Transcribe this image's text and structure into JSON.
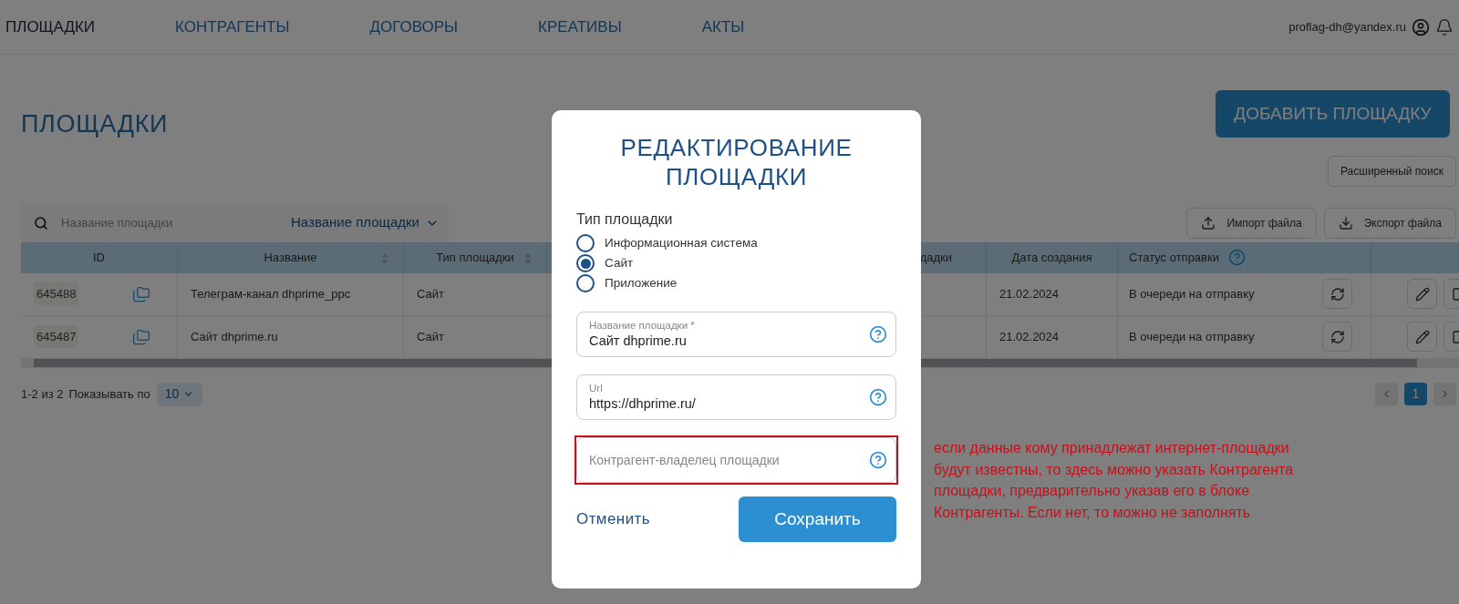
{
  "nav": {
    "items": [
      {
        "label": "ПЛОЩАДКИ",
        "selected": true
      },
      {
        "label": "КОНТРАГЕНТЫ",
        "selected": false
      },
      {
        "label": "ДОГОВОРЫ",
        "selected": false
      },
      {
        "label": "КРЕАТИВЫ",
        "selected": false
      },
      {
        "label": "АКТЫ",
        "selected": false
      }
    ],
    "user_email": "proflag-dh@yandex.ru"
  },
  "page": {
    "title": "ПЛОЩАДКИ",
    "add_button": "ДОБАВИТЬ ПЛОЩАДКУ",
    "advanced_search_button": "Расширенный поиск",
    "search": {
      "placeholder": "Название площадки",
      "field_select": "Название площадки"
    },
    "import_button": "Импорт файла",
    "export_button": "Экспорт файла"
  },
  "table": {
    "columns": [
      {
        "label": "ID",
        "sortable": false
      },
      {
        "label": "Название",
        "sortable": true
      },
      {
        "label": "Тип площадки",
        "sortable": true
      },
      {
        "label": "дадки"
      },
      {
        "label": "Дата создания",
        "sortable": false
      },
      {
        "label": "Статус отправки",
        "sortable": false
      }
    ],
    "rows": [
      {
        "id": "645488",
        "name": "Телеграм-канал dhprime_ppc",
        "type": "Сайт",
        "created": "21.02.2024",
        "status": "В очереди на отправку"
      },
      {
        "id": "645487",
        "name": "Сайт dhprime.ru",
        "type": "Сайт",
        "created": "21.02.2024",
        "status": "В очереди на отправку"
      }
    ]
  },
  "pagination": {
    "range": "1-2 из 2",
    "per_page_label": "Показывать по",
    "per_page": "10",
    "pages": [
      {
        "label": "1",
        "selected": true
      }
    ]
  },
  "modal": {
    "title": "РЕДАКТИРОВАНИЕ ПЛОЩАДКИ",
    "type_group": {
      "label": "Тип площадки",
      "options": [
        {
          "label": "Информационная система",
          "selected": false
        },
        {
          "label": "Сайт",
          "selected": true
        },
        {
          "label": "Приложение",
          "selected": false
        }
      ]
    },
    "fields": [
      {
        "label": "Название площадки *",
        "value": "Сайт dhprime.ru",
        "highlighted": false
      },
      {
        "label": "Url",
        "value": "https://dhprime.ru/",
        "highlighted": false
      },
      {
        "placeholder": "Контрагент-владелец площадки",
        "highlighted": true
      }
    ],
    "cancel_button": "Отменить",
    "save_button": "Сохранить"
  },
  "annotation": {
    "text": "если данные кому принадлежат интернет-площадки будут известны, то здесь можно указать Контрагента площадки, предварительно указав его в блоке Контрагенты. Если нет, то можно не заполнять"
  }
}
